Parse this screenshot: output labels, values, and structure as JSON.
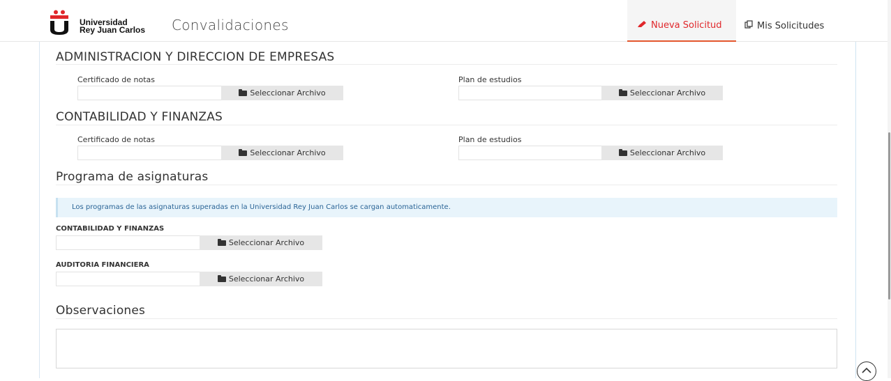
{
  "header": {
    "logo_line1": "Universidad",
    "logo_line2": "Rey Juan Carlos",
    "app_title": "Convalidaciones",
    "nav_new": "Nueva Solicitud",
    "nav_mine": "Mis Solicitudes",
    "colors": {
      "active": "#e0272b",
      "accent_border": "#e4572e"
    }
  },
  "sections": [
    {
      "title": "ADMINISTRACION Y DIRECCION DE EMPRESAS",
      "left_label": "Certificado de notas",
      "right_label": "Plan de estudios",
      "button": "Seleccionar Archivo"
    },
    {
      "title": "CONTABILIDAD Y FINANZAS",
      "left_label": "Certificado de notas",
      "right_label": "Plan de estudios",
      "button": "Seleccionar Archivo"
    }
  ],
  "programa": {
    "title": "Programa de asignaturas",
    "info": "Los programas de las asignaturas superadas en la Universidad Rey Juan Carlos se cargan automaticamente.",
    "items": [
      {
        "label": "CONTABILIDAD Y FINANZAS",
        "button": "Seleccionar Archivo"
      },
      {
        "label": "AUDITORIA FINANCIERA",
        "button": "Seleccionar Archivo"
      }
    ]
  },
  "observaciones": {
    "title": "Observaciones"
  },
  "icons": {
    "logo": "urjc-logo-icon",
    "pencil": "pencil-icon",
    "copy": "copy-icon",
    "folder": "folder-icon",
    "scroll_top": "chevron-up-icon"
  }
}
